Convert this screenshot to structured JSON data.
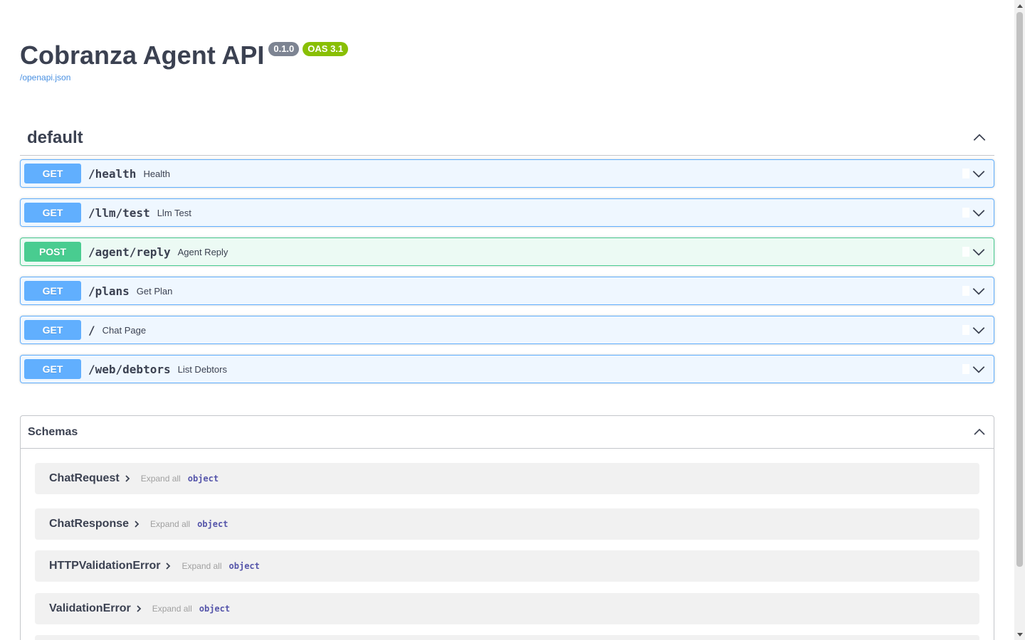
{
  "header": {
    "title": "Cobranza Agent API",
    "version_badge": "0.1.0",
    "oas_badge": "OAS 3.1",
    "spec_link": "/openapi.json"
  },
  "tag": {
    "name": "default",
    "collapse_icon": "chevron-up-icon"
  },
  "operations": [
    {
      "method": "GET",
      "path": "/health",
      "summary": "Health"
    },
    {
      "method": "GET",
      "path": "/llm/test",
      "summary": "Llm Test"
    },
    {
      "method": "POST",
      "path": "/agent/reply",
      "summary": "Agent Reply"
    },
    {
      "method": "GET",
      "path": "/plans",
      "summary": "Get Plan"
    },
    {
      "method": "GET",
      "path": "/",
      "summary": "Chat Page"
    },
    {
      "method": "GET",
      "path": "/web/debtors",
      "summary": "List Debtors"
    }
  ],
  "schemas": {
    "title": "Schemas",
    "expand_label": "Expand all",
    "models": [
      {
        "name": "ChatRequest",
        "type": "object"
      },
      {
        "name": "ChatResponse",
        "type": "object"
      },
      {
        "name": "HTTPValidationError",
        "type": "object"
      },
      {
        "name": "ValidationError",
        "type": "object"
      }
    ]
  },
  "colors": {
    "get": "#61affe",
    "post": "#49cc90",
    "link": "#4990e2",
    "version_badge": "#7d8492",
    "oas_badge": "#89bf04"
  }
}
